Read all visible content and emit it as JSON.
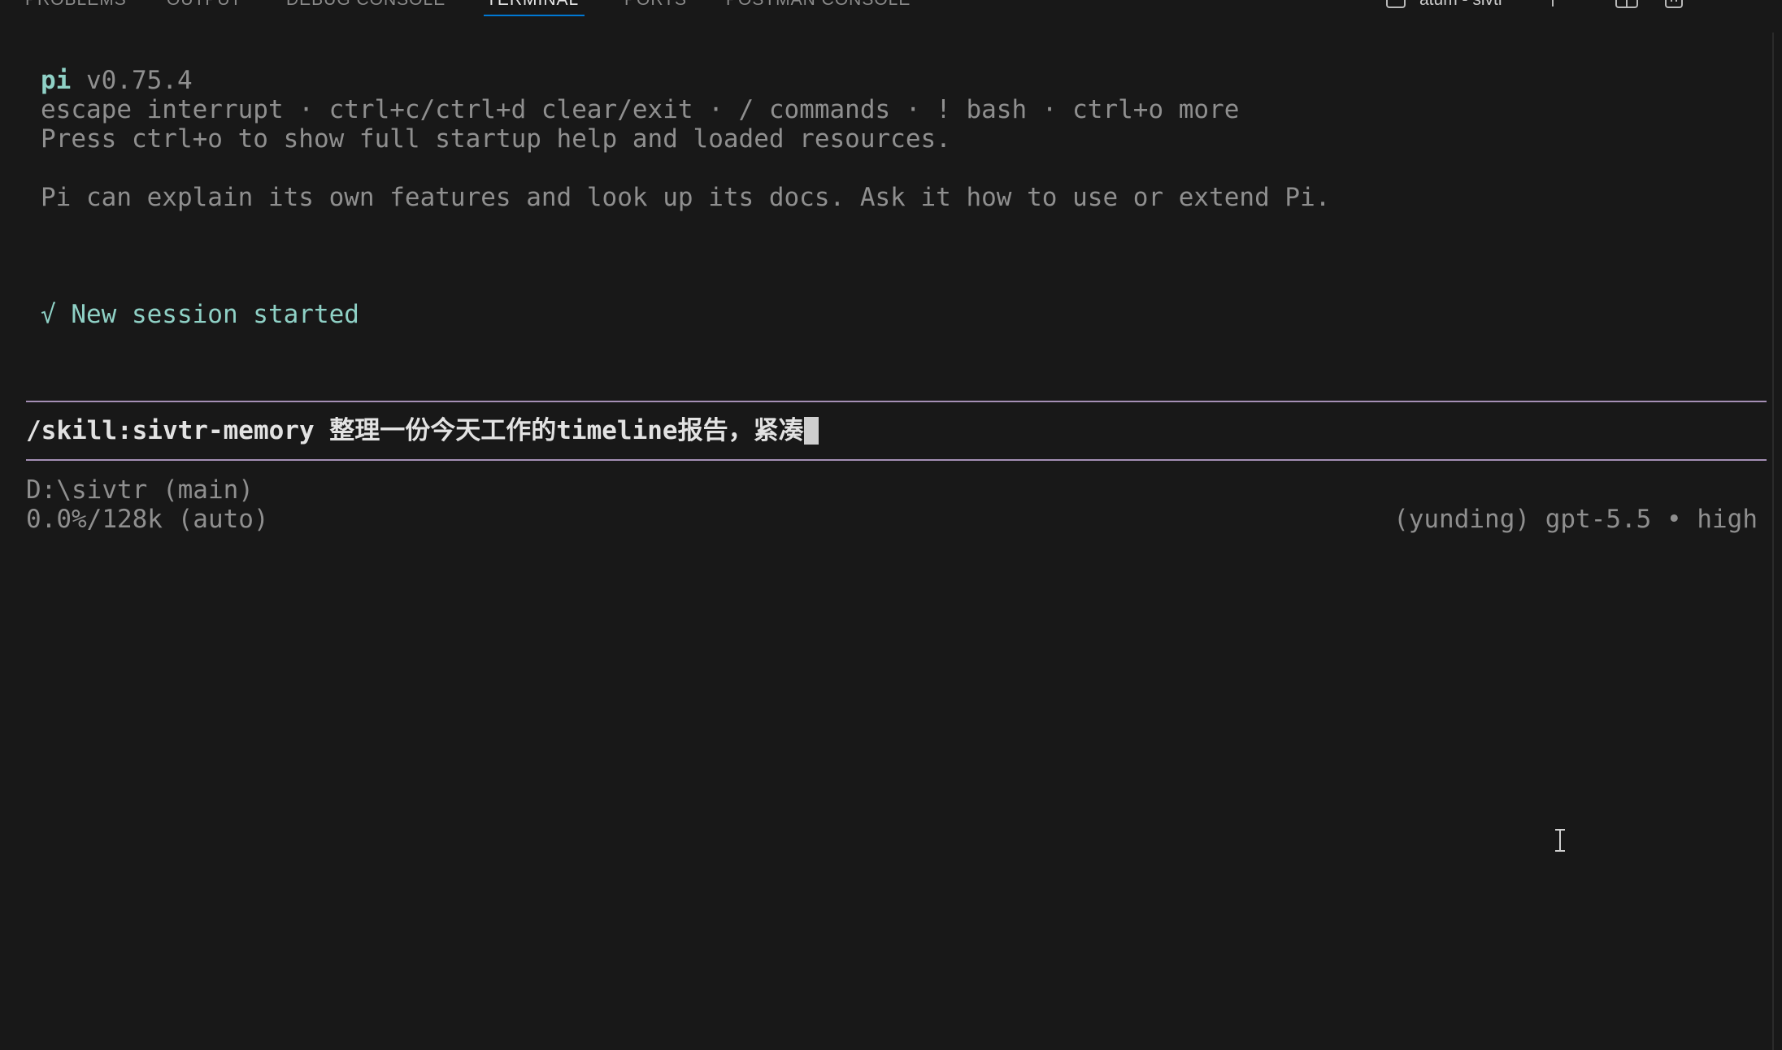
{
  "panel": {
    "tabs": [
      {
        "label": "PROBLEMS"
      },
      {
        "label": "OUTPUT"
      },
      {
        "label": "DEBUG CONSOLE"
      },
      {
        "label": "TERMINAL",
        "active": true
      },
      {
        "label": "PORTS"
      },
      {
        "label": "POSTMAN CONSOLE"
      }
    ],
    "terminal_instance_label": "atum - sivtr",
    "accent_color": "#0078d4"
  },
  "terminal": {
    "header": {
      "app_name": "pi",
      "version": "v0.75.4",
      "keys_hint": "escape interrupt · ctrl+c/ctrl+d clear/exit · / commands · ! bash · ctrl+o more",
      "startup_hint": "Press ctrl+o to show full startup help and loaded resources.",
      "about": "Pi can explain its own features and look up its docs. Ask it how to use or extend Pi."
    },
    "session_message": "√ New session started",
    "input": {
      "value": "/skill:sivtr-memory 整理一份今天工作的timeline报告，紧凑"
    },
    "status": {
      "cwd": "D:\\sivtr (main)",
      "context": "0.0%/128k (auto)",
      "model": "(yunding) gpt-5.5 • high"
    },
    "colors": {
      "background": "#181818",
      "accent_text": "#8fd1c6",
      "dim_text": "#8f8f8f",
      "input_rule": "#a58fb5"
    }
  }
}
